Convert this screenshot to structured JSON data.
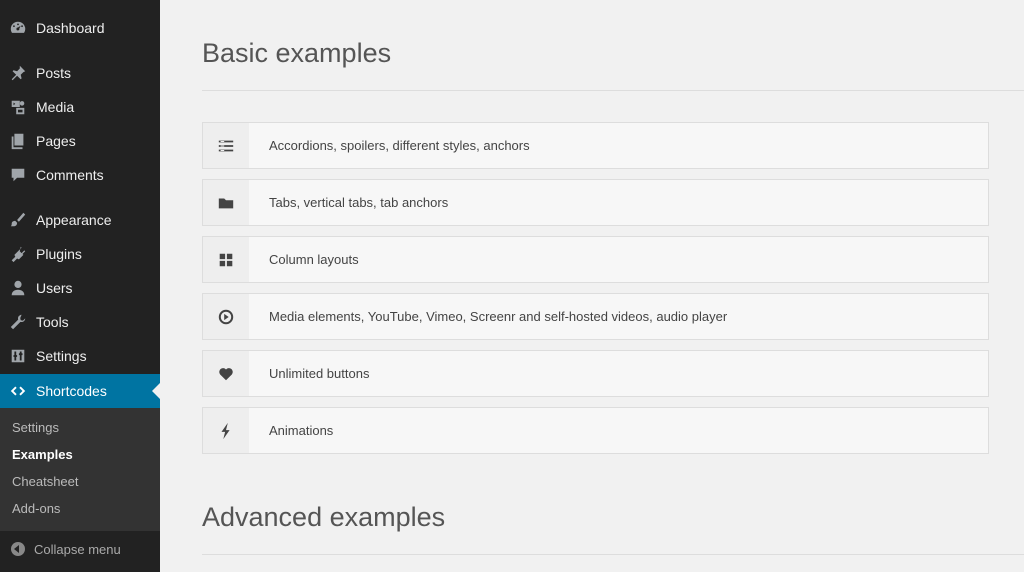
{
  "sidebar": {
    "items": [
      {
        "label": "Dashboard",
        "icon": "dashboard-icon"
      },
      {
        "label": "Posts",
        "icon": "pin-icon"
      },
      {
        "label": "Media",
        "icon": "media-icon"
      },
      {
        "label": "Pages",
        "icon": "pages-icon"
      },
      {
        "label": "Comments",
        "icon": "comment-icon"
      },
      {
        "label": "Appearance",
        "icon": "brush-icon"
      },
      {
        "label": "Plugins",
        "icon": "plug-icon"
      },
      {
        "label": "Users",
        "icon": "user-icon"
      },
      {
        "label": "Tools",
        "icon": "wrench-icon"
      },
      {
        "label": "Settings",
        "icon": "sliders-icon"
      },
      {
        "label": "Shortcodes",
        "icon": "code-icon",
        "active": true
      }
    ],
    "submenu": [
      "Settings",
      "Examples",
      "Cheatsheet",
      "Add-ons"
    ],
    "submenu_current": "Examples",
    "collapse_label": "Collapse menu"
  },
  "main": {
    "basic_title": "Basic examples",
    "examples": [
      {
        "label": "Accordions, spoilers, different styles, anchors",
        "icon": "list-icon"
      },
      {
        "label": "Tabs, vertical tabs, tab anchors",
        "icon": "folder-icon"
      },
      {
        "label": "Column layouts",
        "icon": "grid-icon"
      },
      {
        "label": "Media elements, YouTube, Vimeo, Screenr and self-hosted videos, audio player",
        "icon": "play-circle-icon"
      },
      {
        "label": "Unlimited buttons",
        "icon": "heart-icon"
      },
      {
        "label": "Animations",
        "icon": "bolt-icon"
      }
    ],
    "advanced_title": "Advanced examples"
  },
  "colors": {
    "sidebar_bg": "#222222",
    "accent": "#0074a2",
    "submenu_bg": "#333333",
    "content_bg": "#f1f1f1"
  }
}
